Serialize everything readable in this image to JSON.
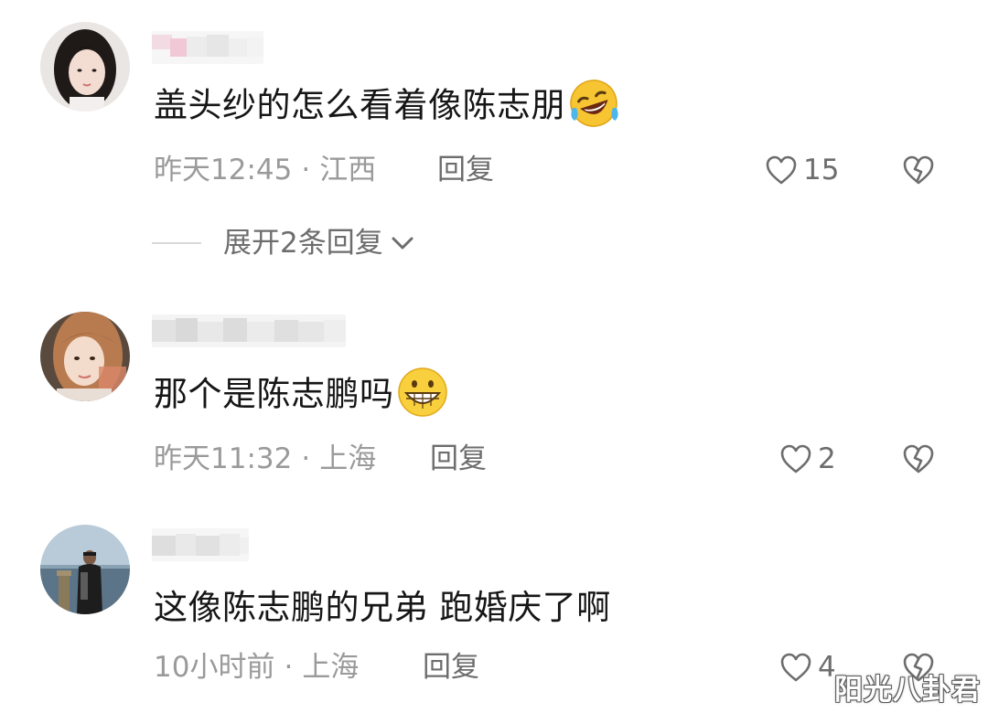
{
  "comments": [
    {
      "text": "盖头纱的怎么看着像陈志朋",
      "emoji": "laughing-tears-emoji",
      "time": "昨天12:45",
      "location": "江西",
      "reply_label": "回复",
      "likes": "15"
    },
    {
      "text": "那个是陈志鹏吗",
      "emoji": "grinning-emoji",
      "time": "昨天11:32",
      "location": "上海",
      "reply_label": "回复",
      "likes": "2"
    },
    {
      "text": "这像陈志鹏的兄弟 跑婚庆了啊",
      "time": "10小时前",
      "location": "上海",
      "reply_label": "回复",
      "likes": "4"
    }
  ],
  "expand_replies": {
    "label": "展开2条回复",
    "icon": "chevron-down-icon"
  },
  "separator": "·",
  "watermark": "阳光八卦君",
  "colors": {
    "meta_text": "#9a9a9a",
    "action_text": "#6d6d6d",
    "body_text": "#161616"
  },
  "icons": {
    "like": "heart-outline-icon",
    "dislike": "broken-heart-icon"
  }
}
